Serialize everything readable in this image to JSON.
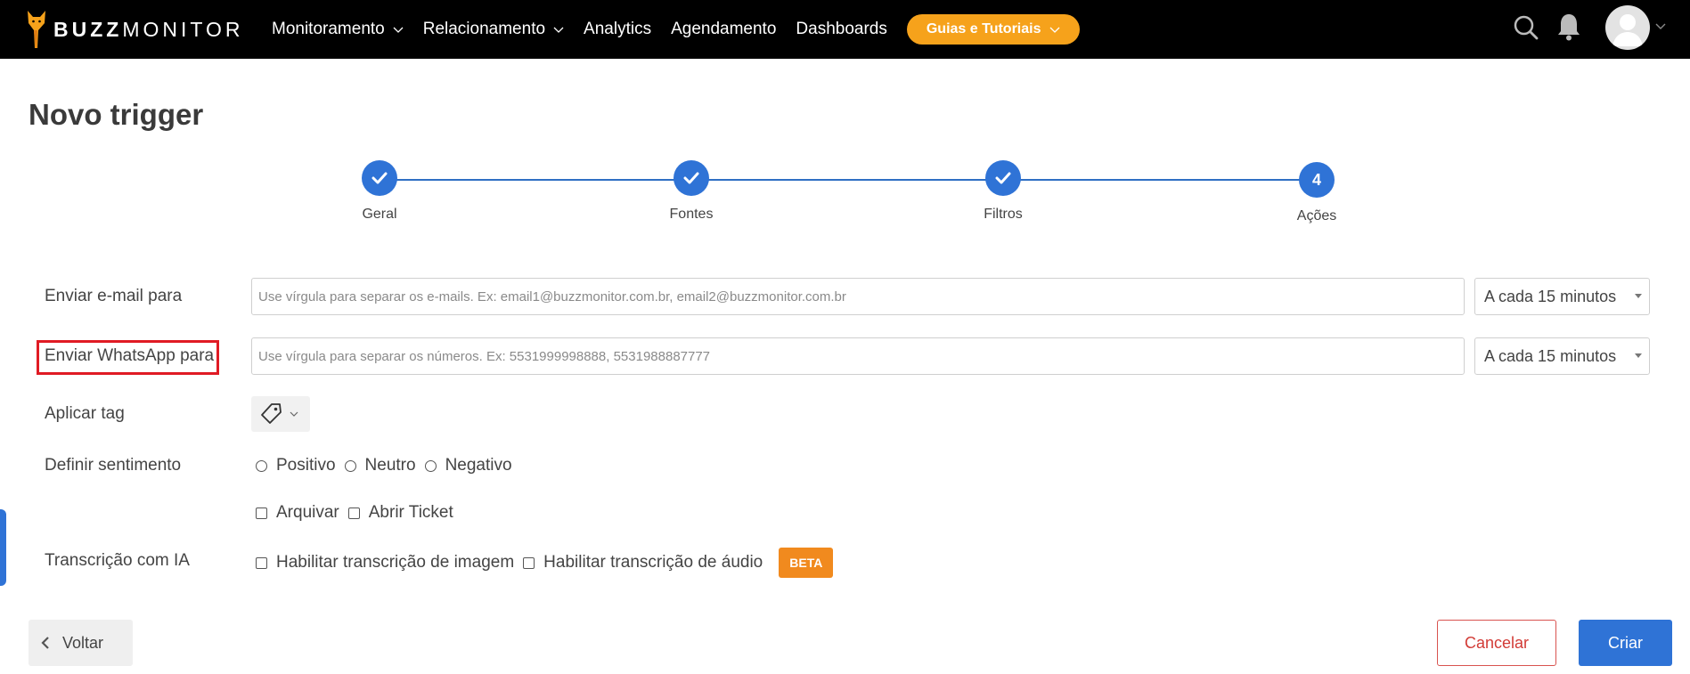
{
  "brand": {
    "name_bold": "BUZZ",
    "name_light": "MONITOR",
    "accent_color": "#f6a21b",
    "primary_color": "#2f73d6"
  },
  "nav": {
    "items": [
      {
        "label": "Monitoramento",
        "has_dropdown": true
      },
      {
        "label": "Relacionamento",
        "has_dropdown": true
      },
      {
        "label": "Analytics",
        "has_dropdown": false
      },
      {
        "label": "Agendamento",
        "has_dropdown": false
      },
      {
        "label": "Dashboards",
        "has_dropdown": false
      }
    ],
    "guide_button": "Guias e Tutoriais",
    "icons": [
      "search-icon",
      "bell-icon",
      "avatar",
      "chevron-down-icon"
    ]
  },
  "page": {
    "title": "Novo trigger"
  },
  "stepper": {
    "steps": [
      {
        "label": "Geral",
        "status": "done"
      },
      {
        "label": "Fontes",
        "status": "done"
      },
      {
        "label": "Filtros",
        "status": "done"
      },
      {
        "label": "Ações",
        "status": "current",
        "number": "4"
      }
    ]
  },
  "form": {
    "email": {
      "label": "Enviar e-mail para",
      "value": "",
      "placeholder": "Use vírgula para separar os e-mails. Ex: email1@buzzmonitor.com.br, email2@buzzmonitor.com.br",
      "frequency": "A cada 15 minutos"
    },
    "whatsapp": {
      "label": "Enviar WhatsApp para",
      "value": "",
      "placeholder": "Use vírgula para separar os números. Ex: 5531999998888, 5531988887777",
      "frequency": "A cada 15 minutos",
      "highlighted": true
    },
    "tag": {
      "label": "Aplicar tag"
    },
    "sentiment": {
      "label": "Definir sentimento",
      "options": [
        "Positivo",
        "Neutro",
        "Negativo"
      ]
    },
    "actions": {
      "archive": "Arquivar",
      "open_ticket": "Abrir Ticket"
    },
    "transcription": {
      "label": "Transcrição com IA",
      "image": "Habilitar transcrição de imagem",
      "audio": "Habilitar transcrição de áudio",
      "badge": "BETA"
    }
  },
  "footer": {
    "back": "Voltar",
    "cancel": "Cancelar",
    "create": "Criar"
  }
}
